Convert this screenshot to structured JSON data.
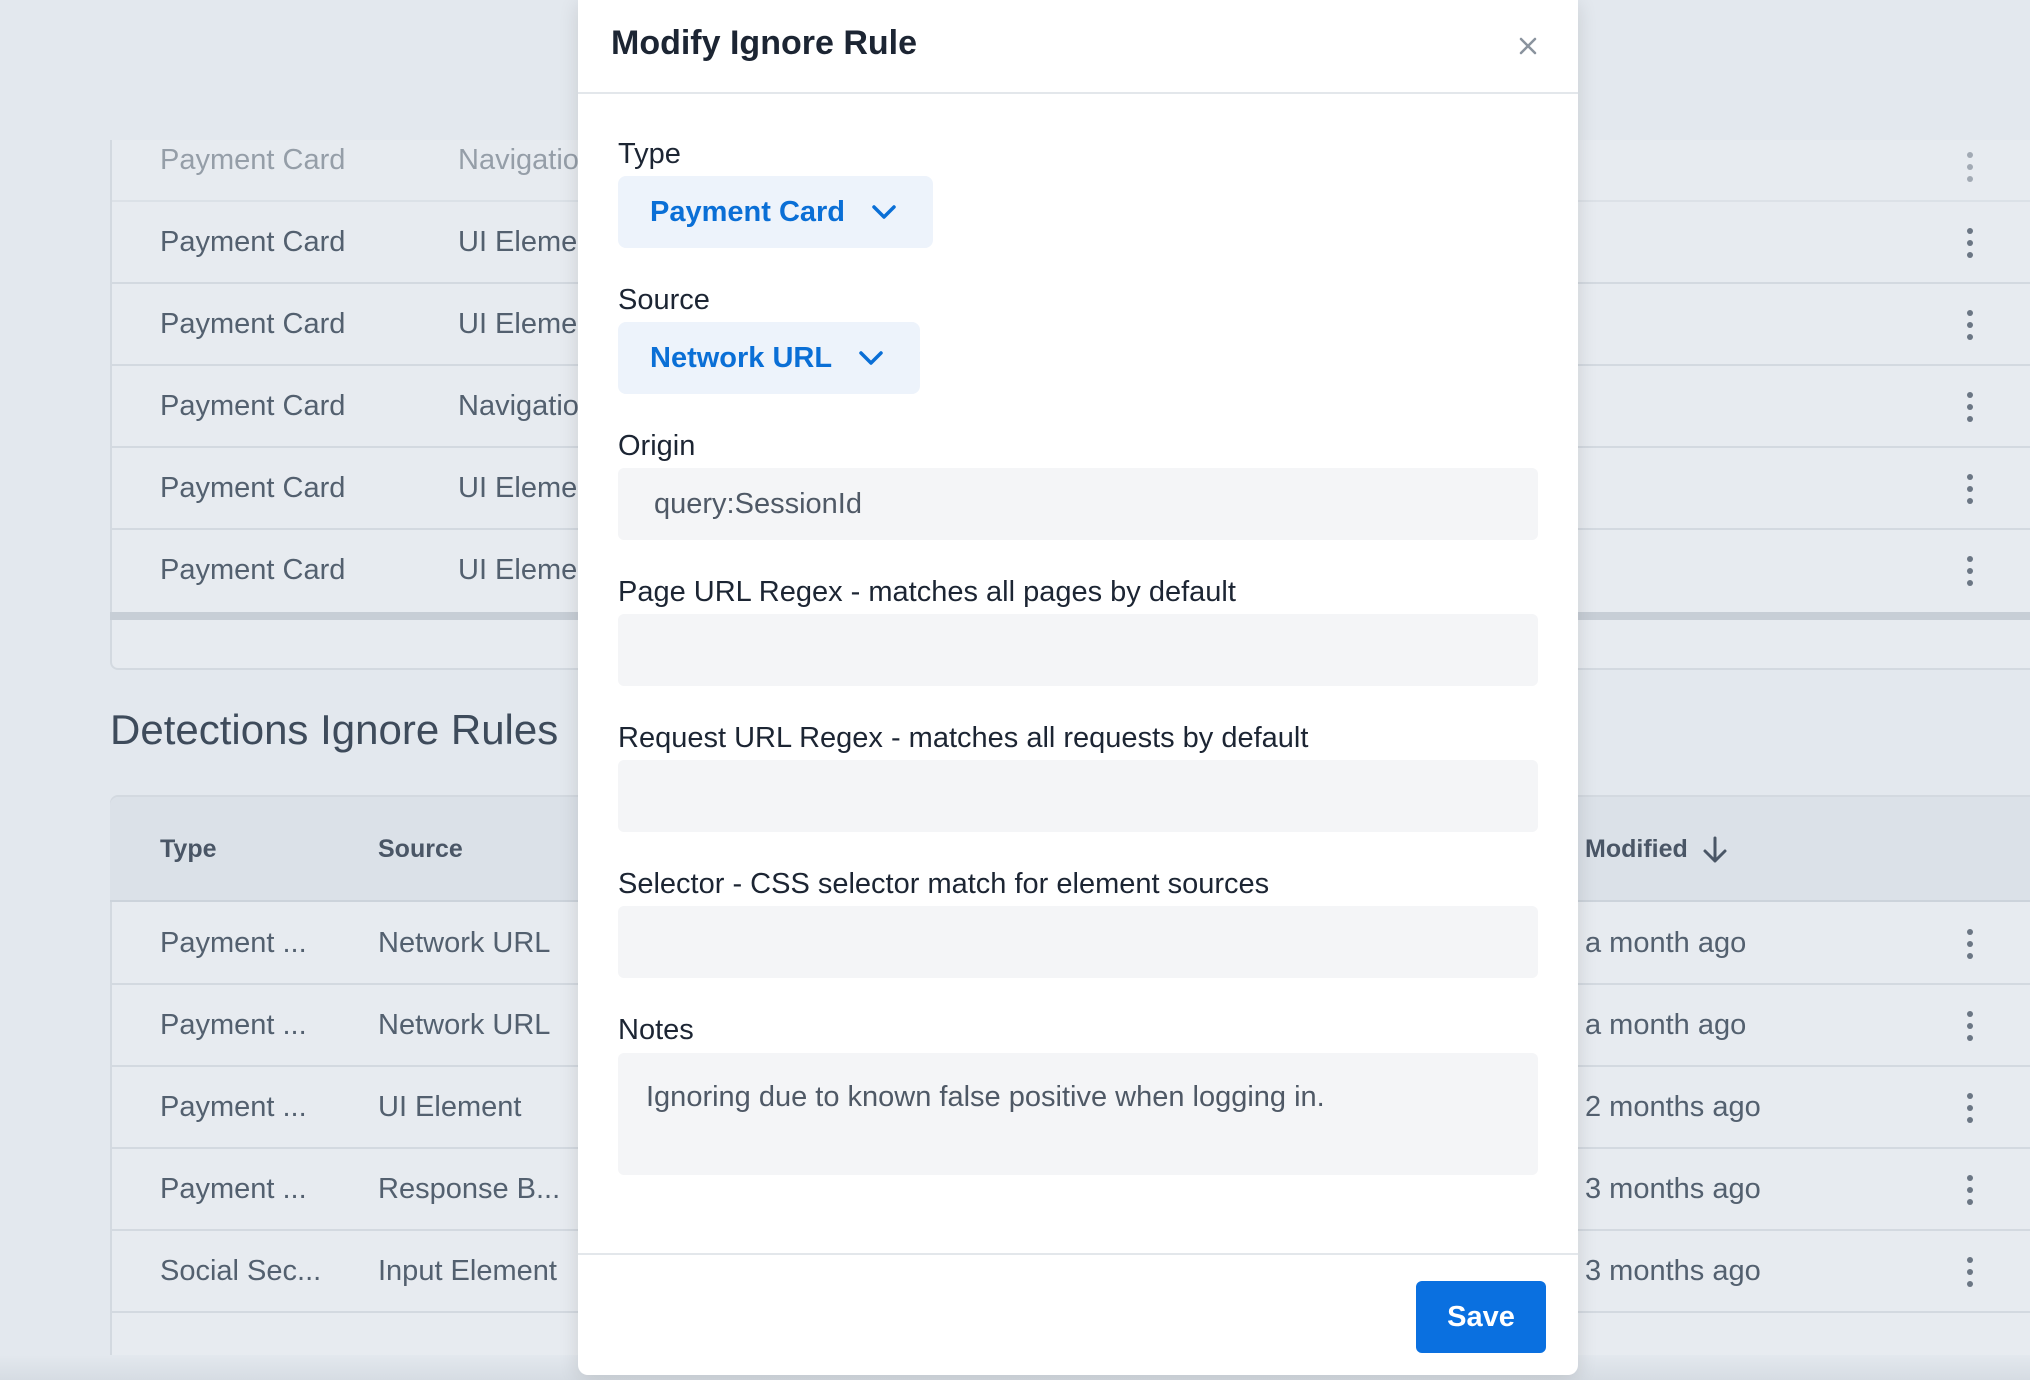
{
  "background": {
    "top_table": {
      "rows": [
        {
          "type": "Payment Card",
          "source": "Navigatio",
          "faded": true
        },
        {
          "type": "Payment Card",
          "source": "UI Eleme"
        },
        {
          "type": "Payment Card",
          "source": "UI Eleme"
        },
        {
          "type": "Payment Card",
          "source": "Navigatio"
        },
        {
          "type": "Payment Card",
          "source": "UI Eleme"
        },
        {
          "type": "Payment Card",
          "source": "UI Eleme"
        }
      ]
    },
    "section_heading": "Detections Ignore Rules",
    "bottom_table": {
      "headers": {
        "type": "Type",
        "source": "Source",
        "modified": "Modified"
      },
      "rows": [
        {
          "type": "Payment ...",
          "source": "Network URL",
          "modified": "a month ago"
        },
        {
          "type": "Payment ...",
          "source": "Network URL",
          "modified": "a month ago"
        },
        {
          "type": "Payment ...",
          "source": "UI Element",
          "modified": "2 months ago"
        },
        {
          "type": "Payment ...",
          "source": "Response B...",
          "modified": "3 months ago"
        },
        {
          "type": "Social Sec...",
          "source": "Input Element",
          "modified": "3 months ago"
        }
      ]
    }
  },
  "modal": {
    "title": "Modify Ignore Rule",
    "close_icon": "close-icon",
    "fields": {
      "type": {
        "label": "Type",
        "value": "Payment Card"
      },
      "source": {
        "label": "Source",
        "value": "Network URL"
      },
      "origin": {
        "label": "Origin",
        "value": "query:SessionId"
      },
      "page_url_regex": {
        "label": "Page URL Regex - matches all pages by default",
        "value": ""
      },
      "request_url_regex": {
        "label": "Request URL Regex - matches all requests by default",
        "value": ""
      },
      "selector": {
        "label": "Selector - CSS selector match for element sources",
        "value": ""
      },
      "notes": {
        "label": "Notes",
        "value": "Ignoring due to known false positive when logging in."
      }
    },
    "save_label": "Save"
  },
  "colors": {
    "accent": "#0a70e0",
    "dropdown_text": "#0a6fd6",
    "dropdown_bg": "#edf3fb",
    "field_bg": "#f4f5f7",
    "page_bg": "#e3e8ee"
  }
}
